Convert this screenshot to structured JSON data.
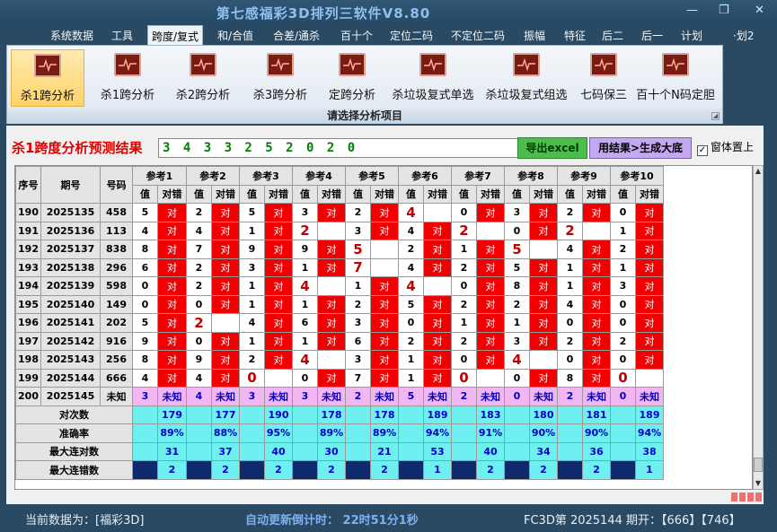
{
  "window": {
    "title": "第七感福彩3D排列三软件V8.80",
    "min": "—",
    "restore": "❐",
    "close": "✕"
  },
  "menu": [
    "系统数据",
    "工具",
    "跨度/复式",
    "和/合值",
    "合差/通杀",
    "百十个",
    "定位二码",
    "不定位二码",
    "振幅",
    "特征",
    "后二",
    "后一",
    "计划",
    "·划2"
  ],
  "menu_active": 2,
  "ribbon": {
    "buttons": [
      "杀1跨分析",
      "杀1跨分析",
      "杀2跨分析",
      "杀3跨分析",
      "定跨分析",
      "杀垃圾复式单选",
      "杀垃圾复式组选",
      "七码保三",
      "百十个N码定胆"
    ],
    "selected": 0,
    "group_label": "请选择分析项目",
    "icon": "chart-icon"
  },
  "panel": {
    "title": "杀1跨度分析预测结果",
    "code": "3 4 3 3 2 5 2 0 2 0",
    "export_label": "导出excel",
    "generate_label": "用结果>生成大底",
    "topmost_label": "窗体置上",
    "topmost_checked": "✓"
  },
  "table": {
    "h_seq": "序号",
    "h_issue": "期号",
    "h_code": "号码",
    "refs": [
      "参考1",
      "参考2",
      "参考3",
      "参考4",
      "参考5",
      "参考6",
      "参考7",
      "参考8",
      "参考9",
      "参考10"
    ],
    "sub_val": "值",
    "sub_ok": "对错",
    "ok_text": "对",
    "rows": [
      {
        "seq": "190",
        "issue": "2025135",
        "code": "458",
        "v": [
          "5",
          "2",
          "5",
          "3",
          "2",
          "4",
          "0",
          "3",
          "2",
          "0"
        ],
        "ok": [
          1,
          1,
          1,
          1,
          1,
          0,
          1,
          1,
          1,
          1
        ],
        "big": [
          0,
          0,
          0,
          0,
          0,
          1,
          0,
          0,
          0,
          0
        ]
      },
      {
        "seq": "191",
        "issue": "2025136",
        "code": "113",
        "v": [
          "4",
          "4",
          "1",
          "2",
          "3",
          "4",
          "2",
          "0",
          "2",
          "1"
        ],
        "ok": [
          1,
          1,
          1,
          0,
          1,
          1,
          0,
          1,
          0,
          1
        ],
        "big": [
          0,
          0,
          0,
          1,
          0,
          0,
          1,
          0,
          1,
          0
        ]
      },
      {
        "seq": "192",
        "issue": "2025137",
        "code": "838",
        "v": [
          "8",
          "7",
          "9",
          "9",
          "5",
          "2",
          "1",
          "5",
          "4",
          "2"
        ],
        "ok": [
          1,
          1,
          1,
          1,
          0,
          1,
          1,
          0,
          1,
          1
        ],
        "big": [
          0,
          0,
          0,
          0,
          1,
          0,
          0,
          1,
          0,
          0
        ]
      },
      {
        "seq": "193",
        "issue": "2025138",
        "code": "296",
        "v": [
          "6",
          "2",
          "3",
          "1",
          "7",
          "4",
          "2",
          "5",
          "1",
          "1"
        ],
        "ok": [
          1,
          1,
          1,
          1,
          0,
          1,
          1,
          1,
          1,
          1
        ],
        "big": [
          0,
          0,
          0,
          0,
          1,
          0,
          0,
          0,
          0,
          0
        ]
      },
      {
        "seq": "194",
        "issue": "2025139",
        "code": "598",
        "v": [
          "0",
          "2",
          "1",
          "4",
          "1",
          "4",
          "0",
          "8",
          "1",
          "3"
        ],
        "ok": [
          1,
          1,
          1,
          0,
          1,
          0,
          1,
          1,
          1,
          1
        ],
        "big": [
          0,
          0,
          0,
          1,
          0,
          1,
          0,
          0,
          0,
          0
        ]
      },
      {
        "seq": "195",
        "issue": "2025140",
        "code": "149",
        "v": [
          "0",
          "0",
          "1",
          "1",
          "2",
          "5",
          "2",
          "2",
          "4",
          "0"
        ],
        "ok": [
          1,
          1,
          1,
          1,
          1,
          1,
          1,
          1,
          1,
          1
        ],
        "big": [
          0,
          0,
          0,
          0,
          0,
          0,
          0,
          0,
          0,
          0
        ]
      },
      {
        "seq": "196",
        "issue": "2025141",
        "code": "202",
        "v": [
          "5",
          "2",
          "4",
          "6",
          "3",
          "0",
          "1",
          "1",
          "0",
          "0"
        ],
        "ok": [
          1,
          0,
          1,
          1,
          1,
          1,
          1,
          1,
          1,
          1
        ],
        "big": [
          0,
          1,
          0,
          0,
          0,
          0,
          0,
          0,
          0,
          0
        ]
      },
      {
        "seq": "197",
        "issue": "2025142",
        "code": "916",
        "v": [
          "9",
          "0",
          "1",
          "1",
          "6",
          "2",
          "2",
          "3",
          "2",
          "2"
        ],
        "ok": [
          1,
          1,
          1,
          1,
          1,
          1,
          1,
          1,
          1,
          1
        ],
        "big": [
          0,
          0,
          0,
          0,
          0,
          0,
          0,
          0,
          0,
          0
        ]
      },
      {
        "seq": "198",
        "issue": "2025143",
        "code": "256",
        "v": [
          "8",
          "9",
          "2",
          "4",
          "3",
          "1",
          "0",
          "4",
          "0",
          "0"
        ],
        "ok": [
          1,
          1,
          1,
          0,
          1,
          1,
          1,
          0,
          1,
          1
        ],
        "big": [
          0,
          0,
          0,
          1,
          0,
          0,
          0,
          1,
          0,
          0
        ]
      },
      {
        "seq": "199",
        "issue": "2025144",
        "code": "666",
        "v": [
          "4",
          "4",
          "0",
          "0",
          "7",
          "1",
          "0",
          "0",
          "8",
          "0"
        ],
        "ok": [
          1,
          1,
          0,
          1,
          1,
          1,
          0,
          1,
          1,
          0
        ],
        "big": [
          0,
          0,
          1,
          0,
          0,
          0,
          1,
          0,
          0,
          1
        ]
      },
      {
        "seq": "200",
        "issue": "2025145",
        "code": "未知",
        "v": [
          "3",
          "4",
          "3",
          "3",
          "2",
          "5",
          "2",
          "0",
          "2",
          "0"
        ],
        "okText": "未知",
        "pending": true
      }
    ],
    "stats": [
      {
        "label": "对次数",
        "vals": [
          "179",
          "177",
          "190",
          "178",
          "178",
          "189",
          "183",
          "180",
          "181",
          "189"
        ]
      },
      {
        "label": "准确率",
        "vals": [
          "89%",
          "88%",
          "95%",
          "89%",
          "89%",
          "94%",
          "91%",
          "90%",
          "90%",
          "94%"
        ]
      },
      {
        "label": "最大连对数",
        "vals": [
          "31",
          "37",
          "40",
          "30",
          "21",
          "53",
          "40",
          "34",
          "36",
          "38"
        ]
      },
      {
        "label": "最大连错数",
        "vals": [
          "2",
          "2",
          "2",
          "2",
          "2",
          "1",
          "2",
          "2",
          "2",
          "1"
        ]
      }
    ]
  },
  "status": {
    "data_label": "当前数据为：[福彩3D]",
    "countdown": "自动更新倒计时：  22时51分1秒",
    "issue_info": "FC3D第 2025144 期开：【666】【746】"
  },
  "colors": {
    "accent": "#f00000",
    "cyan": "#6ff0f0",
    "pink": "#f2b6f2",
    "title_blue": "#8fc0ee"
  }
}
